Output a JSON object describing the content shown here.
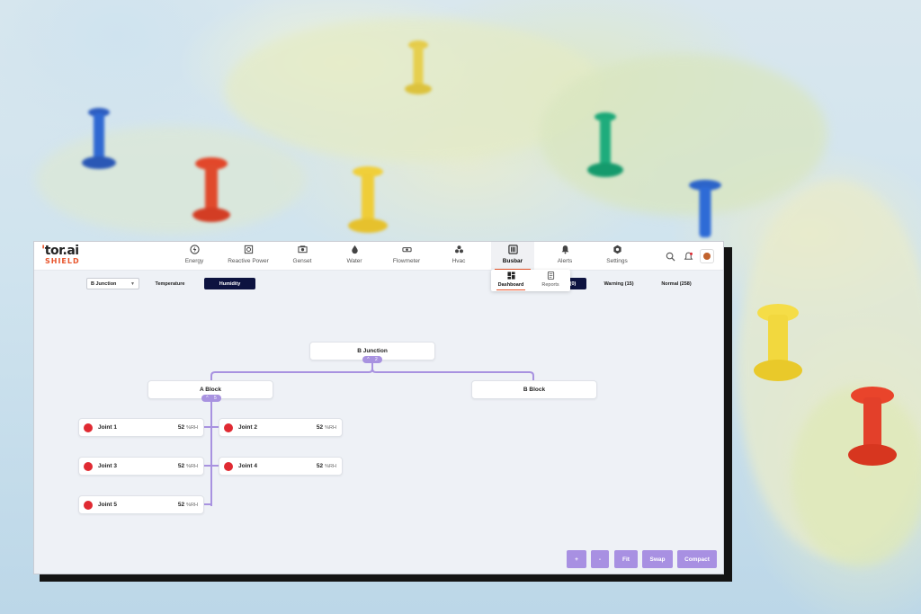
{
  "brand": {
    "name": "tor.ai",
    "product": "SHIELD"
  },
  "nav": [
    {
      "label": "Energy",
      "icon": "energy-icon"
    },
    {
      "label": "Reactive Power",
      "icon": "reactive-power-icon"
    },
    {
      "label": "Genset",
      "icon": "genset-icon"
    },
    {
      "label": "Water",
      "icon": "water-drop-icon"
    },
    {
      "label": "Flowmeter",
      "icon": "flowmeter-icon"
    },
    {
      "label": "Hvac",
      "icon": "hvac-icon"
    },
    {
      "label": "Busbar",
      "icon": "busbar-icon",
      "active": true
    },
    {
      "label": "Alerts",
      "icon": "bell-icon"
    },
    {
      "label": "Settings",
      "icon": "settings-icon"
    }
  ],
  "submenu": [
    {
      "label": "Dashboard",
      "icon": "dashboard-icon",
      "active": true
    },
    {
      "label": "Reports",
      "icon": "reports-icon"
    }
  ],
  "filters": {
    "junction_select": "B Junction",
    "tabs": [
      {
        "label": "Temperature"
      },
      {
        "label": "Humidity",
        "active": true
      }
    ],
    "status": [
      {
        "label": "(0)"
      },
      {
        "label": "Warning (15)"
      },
      {
        "label": "Normal (258)"
      }
    ]
  },
  "tree": {
    "root": {
      "label": "B Junction",
      "count": "2"
    },
    "blocks": [
      {
        "label": "A Block",
        "count": "5"
      },
      {
        "label": "B Block"
      }
    ],
    "joints": [
      {
        "name": "Joint 1",
        "value": "52",
        "unit": "%RH"
      },
      {
        "name": "Joint 2",
        "value": "52",
        "unit": "%RH"
      },
      {
        "name": "Joint 3",
        "value": "52",
        "unit": "%RH"
      },
      {
        "name": "Joint 4",
        "value": "52",
        "unit": "%RH"
      },
      {
        "name": "Joint 5",
        "value": "52",
        "unit": "%RH"
      }
    ]
  },
  "controls": {
    "zoom_in": "+",
    "zoom_out": "-",
    "fit": "Fit",
    "swap": "Swap",
    "compact": "Compact"
  },
  "colors": {
    "accent": "#e8542b",
    "primary_dark": "#0d1340",
    "tree_line": "#a892e0",
    "status_critical": "#e02a32"
  }
}
